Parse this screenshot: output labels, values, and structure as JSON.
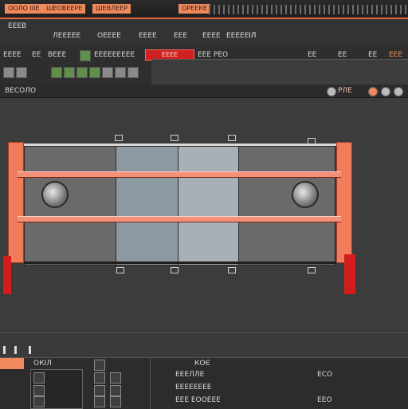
{
  "menu": {
    "items": [
      "ООЛО ІІІЕ",
      "ШЕОВЕЕРЕ",
      "ШЕВЛЕЕР",
      "ОРЕЕКЕ"
    ]
  },
  "toolbar": {
    "row1_labels": [
      "ЕЕЕВ",
      "ЛЕЕЕЕЕ",
      "ОЕЕЕЕ",
      "ЕЕЕЕ",
      "ЕЕЕ",
      "ЕЕЕЕ",
      "ЕЕЕЕЕ",
      "ЕЕЕ"
    ],
    "row1_right": "ІЛ",
    "row2_left": [
      "ЕЕЕЕ",
      "ЕЕ",
      "ВЕЕЕ"
    ],
    "row2_mid": "ЕЕЕЕЕЕЕЕЕ",
    "status_text": "ЕЕЕЕ",
    "status_right": "ЕЕЕ РЕО",
    "right_marks": [
      "ЕЕ",
      "ЕЕ",
      "ЕЕ"
    ],
    "right_end": "ЕЕЕ"
  },
  "view": {
    "title": "ВЕСОЛО",
    "right_icons": [
      "РЛЕ"
    ]
  },
  "bottom": {
    "list_title": "ОКІЛ",
    "column_headers": [
      "",
      "КОЄ"
    ],
    "props": [
      {
        "label": "ЕЕЕЛЛЕ",
        "value": "ЕСО"
      },
      {
        "label": "ЕЕЕЕЕЕЕЕ",
        "value": ""
      },
      {
        "label": "ЕЕЕ ЕООЕЕЕ",
        "value": "ЕЕО"
      }
    ]
  },
  "colors": {
    "accent": "#f07c5c",
    "rail": "#f48f78",
    "alert": "#d31c1c",
    "background": "#3a3a3a"
  }
}
